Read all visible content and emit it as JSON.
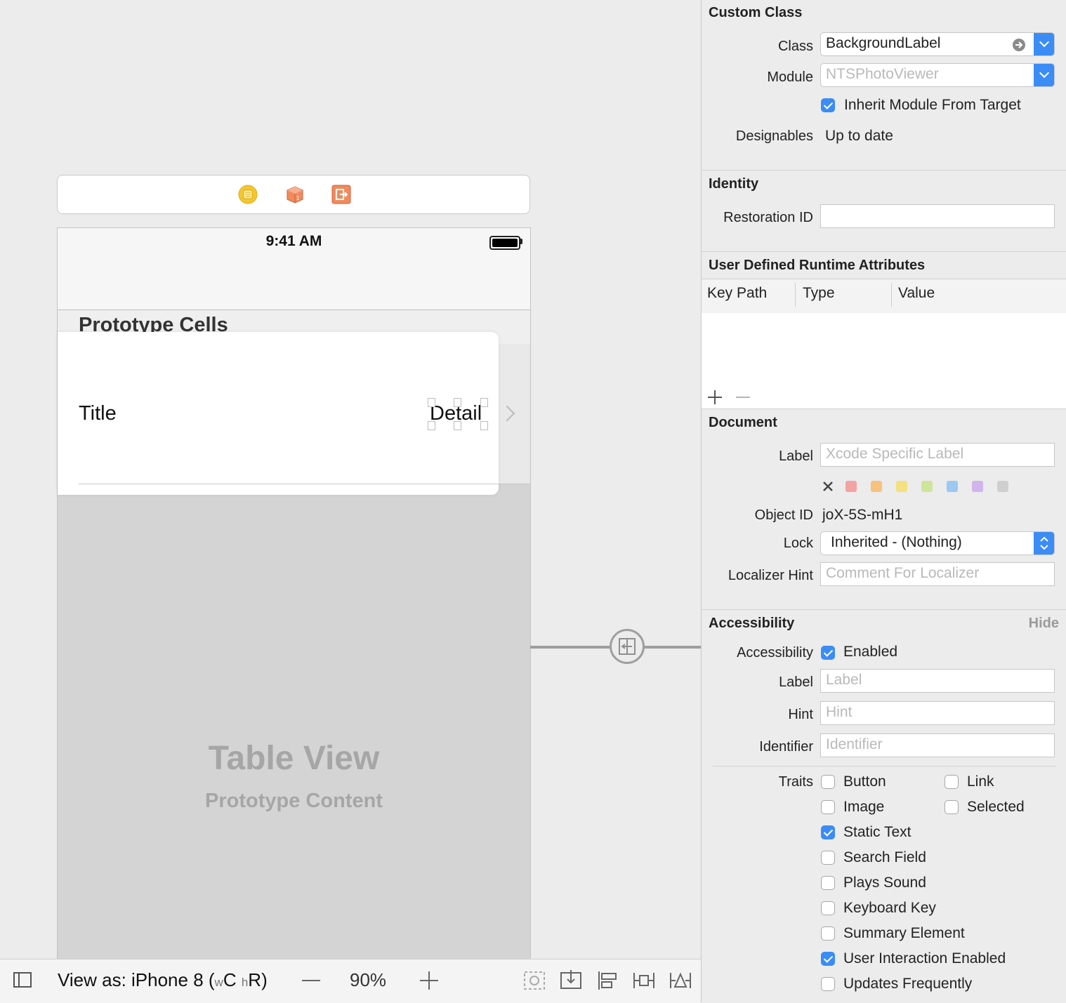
{
  "canvas": {
    "dock_icons": [
      "view-controller-icon",
      "first-responder-icon",
      "exit-icon"
    ],
    "status_time": "9:41 AM",
    "prototype_cells_title": "Prototype Cells",
    "cell_title": "Title",
    "cell_detail": "Detail",
    "table_view_title": "Table View",
    "table_view_subtitle": "Prototype Content"
  },
  "bottom_bar": {
    "view_as_prefix": "View as: iPhone 8 (",
    "size_w": "w",
    "size_c": "C ",
    "size_h": "h",
    "size_r": "R)",
    "zoom": "90%"
  },
  "inspector": {
    "custom_class": {
      "title": "Custom Class",
      "class_label": "Class",
      "class_value": "BackgroundLabel",
      "module_label": "Module",
      "module_placeholder": "NTSPhotoViewer",
      "inherit_module_label": "Inherit Module From Target",
      "inherit_module_checked": true,
      "designables_label": "Designables",
      "designables_value": "Up to date"
    },
    "identity": {
      "title": "Identity",
      "restoration_id_label": "Restoration ID",
      "restoration_id_value": ""
    },
    "runtime_attributes": {
      "title": "User Defined Runtime Attributes",
      "columns": [
        "Key Path",
        "Type",
        "Value"
      ]
    },
    "document": {
      "title": "Document",
      "label_label": "Label",
      "label_placeholder": "Xcode Specific Label",
      "colors": [
        "#f4a3a3",
        "#f6c27e",
        "#f3e07e",
        "#cfe59a",
        "#9cc8f2",
        "#d2b4ec",
        "#cfcfcf"
      ],
      "object_id_label": "Object ID",
      "object_id_value": "joX-5S-mH1",
      "lock_label": "Lock",
      "lock_value": "Inherited - (Nothing)",
      "localizer_hint_label": "Localizer Hint",
      "localizer_hint_placeholder": "Comment For Localizer"
    },
    "accessibility": {
      "title": "Accessibility",
      "hide_label": "Hide",
      "accessibility_label": "Accessibility",
      "enabled_label": "Enabled",
      "label_label": "Label",
      "label_placeholder": "Label",
      "hint_label": "Hint",
      "hint_placeholder": "Hint",
      "identifier_label": "Identifier",
      "identifier_placeholder": "Identifier",
      "traits_label": "Traits",
      "traits": [
        {
          "label": "Button",
          "checked": false
        },
        {
          "label": "Link",
          "checked": false
        },
        {
          "label": "Image",
          "checked": false
        },
        {
          "label": "Selected",
          "checked": false
        },
        {
          "label": "Static Text",
          "checked": true
        },
        {
          "label": "Search Field",
          "checked": false
        },
        {
          "label": "Plays Sound",
          "checked": false
        },
        {
          "label": "Keyboard Key",
          "checked": false
        },
        {
          "label": "Summary Element",
          "checked": false
        },
        {
          "label": "User Interaction Enabled",
          "checked": true
        },
        {
          "label": "Updates Frequently",
          "checked": false
        }
      ]
    }
  },
  "colors": {
    "accent": "#3b8cf6"
  }
}
